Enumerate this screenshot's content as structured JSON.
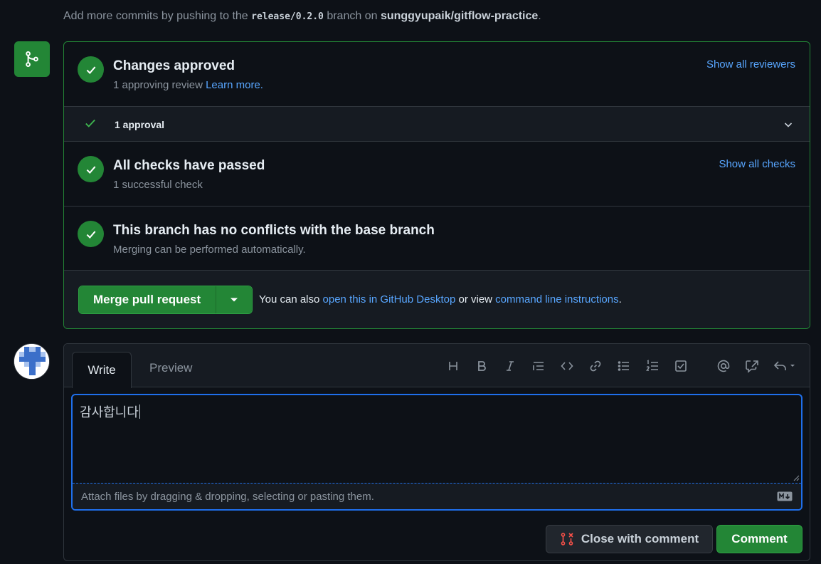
{
  "top_message": {
    "prefix": "Add more commits by pushing to the ",
    "branch": "release/0.2.0",
    "middle": " branch on ",
    "repo": "sunggyupaik/gitflow-practice",
    "suffix": "."
  },
  "merge_box": {
    "approval": {
      "title": "Changes approved",
      "sub_prefix": "1 approving review ",
      "learn_more": "Learn more.",
      "show_all": "Show all reviewers"
    },
    "approval_row": {
      "label": "1 approval"
    },
    "checks": {
      "title": "All checks have passed",
      "sub": "1 successful check",
      "show_all": "Show all checks"
    },
    "conflicts": {
      "title": "This branch has no conflicts with the base branch",
      "sub": "Merging can be performed automatically."
    },
    "merge": {
      "button": "Merge pull request",
      "also_prefix": "You can also ",
      "desktop_link": "open this in GitHub Desktop",
      "also_middle": " or view ",
      "cli_link": "command line instructions",
      "also_suffix": "."
    }
  },
  "comment": {
    "tab_write": "Write",
    "tab_preview": "Preview",
    "text": "감사합니다",
    "attach_hint": "Attach files by dragging & dropping, selecting or pasting them.",
    "close_button": "Close with comment",
    "comment_button": "Comment"
  },
  "colors": {
    "background": "#0d1117",
    "success": "#238636",
    "link": "#58a6ff",
    "focus": "#1f6feb",
    "danger": "#f85149"
  }
}
